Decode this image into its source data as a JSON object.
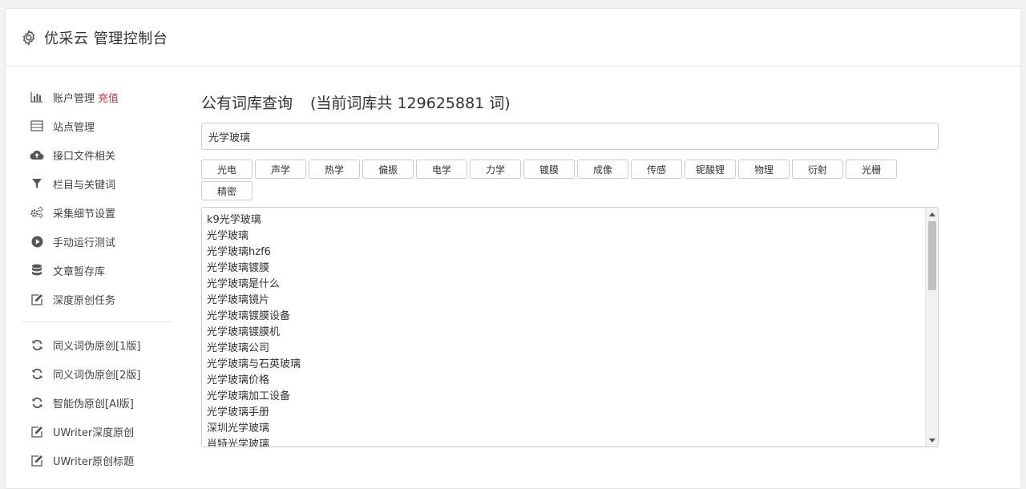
{
  "header": {
    "title": "优采云 管理控制台",
    "icon": "gear-icon"
  },
  "sidebar": {
    "items": [
      {
        "label": "账户管理",
        "extra": "充值",
        "icon": "bar-chart-icon"
      },
      {
        "label": "站点管理",
        "icon": "list-icon"
      },
      {
        "label": "接口文件相关",
        "icon": "cloud-upload-icon"
      },
      {
        "label": "栏目与关键词",
        "icon": "filter-icon"
      },
      {
        "label": "采集细节设置",
        "icon": "cogs-icon"
      },
      {
        "label": "手动运行测试",
        "icon": "play-circle-icon"
      },
      {
        "label": "文章暂存库",
        "icon": "database-icon"
      },
      {
        "label": "深度原创任务",
        "icon": "edit-icon"
      }
    ],
    "items2": [
      {
        "label": "同义词伪原创[1版]",
        "icon": "refresh-icon"
      },
      {
        "label": "同义词伪原创[2版]",
        "icon": "refresh-icon"
      },
      {
        "label": "智能伪原创[AI版]",
        "icon": "refresh-icon"
      },
      {
        "label": "UWriter深度原创",
        "icon": "edit-icon"
      },
      {
        "label": "UWriter原创标题",
        "icon": "edit-icon"
      }
    ]
  },
  "main": {
    "title": "公有词库查询",
    "count_text": "(当前词库共 129625881 词)",
    "search": {
      "value": "光学玻璃"
    },
    "tags": [
      "光电",
      "声学",
      "热学",
      "偏振",
      "电学",
      "力学",
      "镀膜",
      "成像",
      "传感",
      "铌酸锂",
      "物理",
      "衍射",
      "光栅",
      "精密"
    ],
    "results": [
      "k9光学玻璃",
      "光学玻璃",
      "光学玻璃hzf6",
      "光学玻璃镀膜",
      "光学玻璃是什么",
      "光学玻璃镜片",
      "光学玻璃镀膜设备",
      "光学玻璃镀膜机",
      "光学玻璃公司",
      "光学玻璃与石英玻璃",
      "光学玻璃价格",
      "光学玻璃加工设备",
      "光学玻璃手册",
      "深圳光学玻璃",
      "肖特光学玻璃"
    ]
  },
  "colors": {
    "accent_red": "#d9363e",
    "border": "#cccccc",
    "text": "#333333",
    "background": "#f2f2f2"
  }
}
